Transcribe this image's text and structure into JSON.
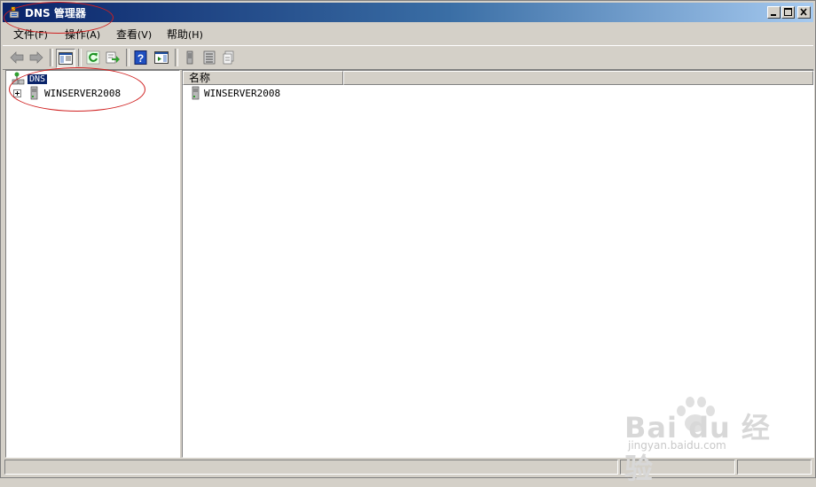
{
  "window": {
    "title": "DNS 管理器",
    "controls": [
      "minimize-icon",
      "maximize-icon",
      "close-icon"
    ]
  },
  "menu": [
    {
      "label": "文件",
      "accel": "(F)"
    },
    {
      "label": "操作",
      "accel": "(A)"
    },
    {
      "label": "查看",
      "accel": "(V)"
    },
    {
      "label": "帮助",
      "accel": "(H)"
    }
  ],
  "toolbar": {
    "buttons": [
      "back-arrow-icon",
      "forward-arrow-icon",
      "show-hide-tree-icon",
      "refresh-icon",
      "export-list-icon",
      "help-icon",
      "action-pane-icon",
      "server-icon",
      "list-icon",
      "properties-icon"
    ]
  },
  "tree": {
    "root_label": "DNS",
    "children": [
      {
        "label": "WINSERVER2008"
      }
    ]
  },
  "list": {
    "columns": [
      "名称",
      ""
    ],
    "rows": [
      {
        "name": "WINSERVER2008"
      }
    ]
  },
  "watermark": {
    "brand": "Bai du 经验",
    "url": "jingyan.baidu.com"
  },
  "colors": {
    "title_gradient_start": "#0a246a",
    "title_gradient_end": "#a6caf0",
    "selection": "#0a246a",
    "annotation": "#d02020",
    "face": "#d4d0c8"
  }
}
